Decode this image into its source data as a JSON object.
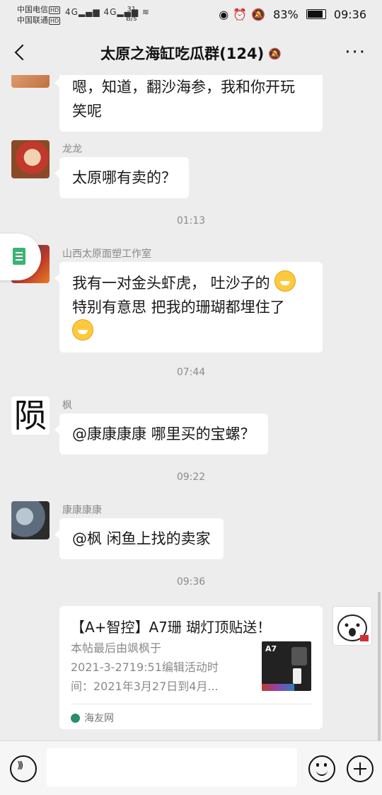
{
  "status_bar": {
    "carrier1": "中国电信",
    "carrier2": "中国联通",
    "hd": "HD",
    "net": "4G",
    "speed_value": "31",
    "speed_unit": "B/s",
    "battery": "83%",
    "time": "09:36"
  },
  "header": {
    "title": "太原之海缸吃瓜群(124)"
  },
  "messages": [
    {
      "type": "text",
      "sender": "",
      "text_line1": "嗯，知道，翻沙海参，我和你开玩",
      "text_line2": "笑呢"
    },
    {
      "type": "text",
      "sender": "龙龙",
      "text": "太原哪有卖的？"
    },
    {
      "type": "time",
      "text": "01:13"
    },
    {
      "type": "text",
      "sender": "山西太原面塑工作室",
      "text_line1": "我有一对金头虾虎， 吐沙子的",
      "text_line2": "特别有意思 把我的珊瑚都埋住了"
    },
    {
      "type": "time",
      "text": "07:44"
    },
    {
      "type": "text",
      "sender": "枫",
      "avatar_text": "陨",
      "text": "@康康康康  哪里买的宝螺？"
    },
    {
      "type": "time",
      "text": "09:22"
    },
    {
      "type": "text",
      "sender": "康康康康",
      "text": "@枫  闲鱼上找的卖家"
    },
    {
      "type": "time",
      "text": "09:36"
    },
    {
      "type": "card",
      "title": "【A+智控】A7珊 瑚灯顶贴送！",
      "desc_line1": "本帖最后由飒枫于",
      "desc_line2": "2021-3-2719:51编辑活动时",
      "desc_line3": "间：2021年3月27日到4月...",
      "thumb_label": "A7",
      "source": "海友网"
    }
  ]
}
